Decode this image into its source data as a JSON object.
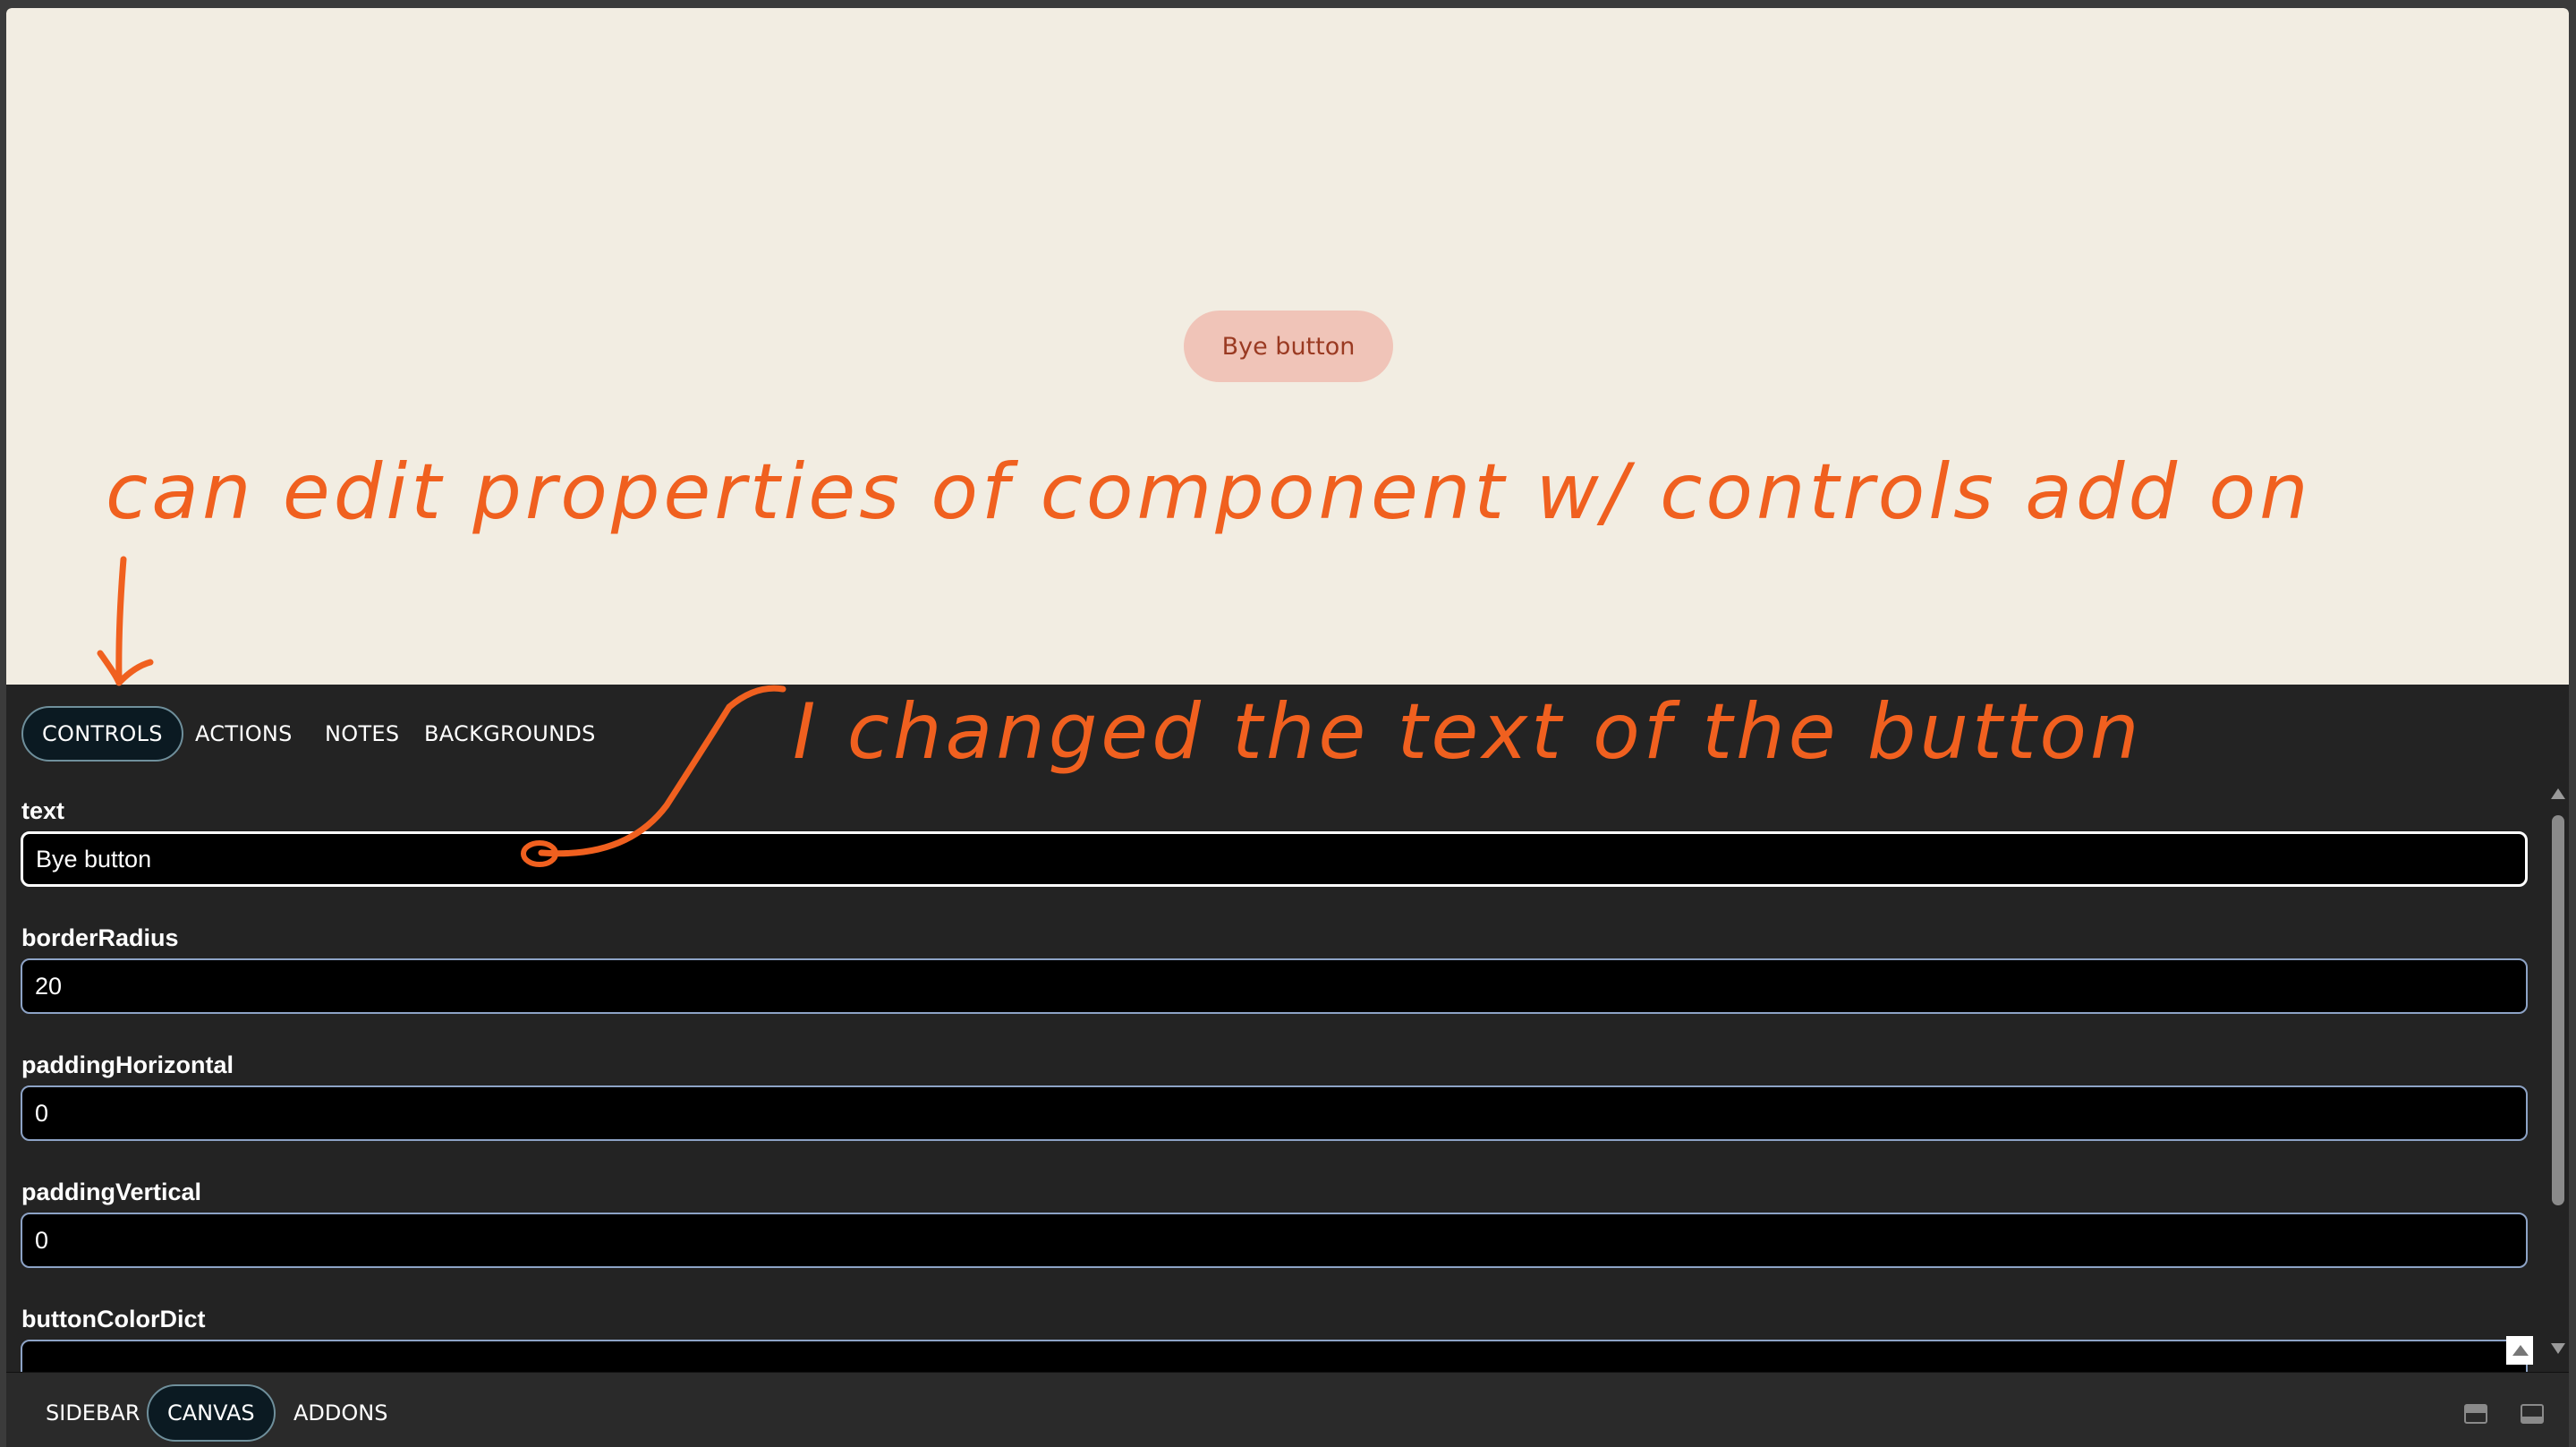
{
  "canvas": {
    "preview_button_text": "Bye button",
    "background": "#f2ede2"
  },
  "addon_tabs": [
    {
      "label": "CONTROLS",
      "active": true
    },
    {
      "label": "ACTIONS",
      "active": false
    },
    {
      "label": "NOTES",
      "active": false
    },
    {
      "label": "BACKGROUNDS",
      "active": false
    }
  ],
  "controls": [
    {
      "label": "text",
      "value": "Bye button"
    },
    {
      "label": "borderRadius",
      "value": "20"
    },
    {
      "label": "paddingHorizontal",
      "value": "0"
    },
    {
      "label": "paddingVertical",
      "value": "0"
    },
    {
      "label": "buttonColorDict",
      "value": "{"
    }
  ],
  "bottom_tabs": [
    {
      "label": "SIDEBAR",
      "active": false
    },
    {
      "label": "CANVAS",
      "active": true
    },
    {
      "label": "ADDONS",
      "active": false
    }
  ],
  "bottom_icons": [
    "panel-top-icon",
    "panel-bottom-icon"
  ],
  "annotations": {
    "top_note": "can edit properties of component w/ controls add on",
    "right_note": "I changed the text of the button",
    "color": "#f0601f"
  }
}
